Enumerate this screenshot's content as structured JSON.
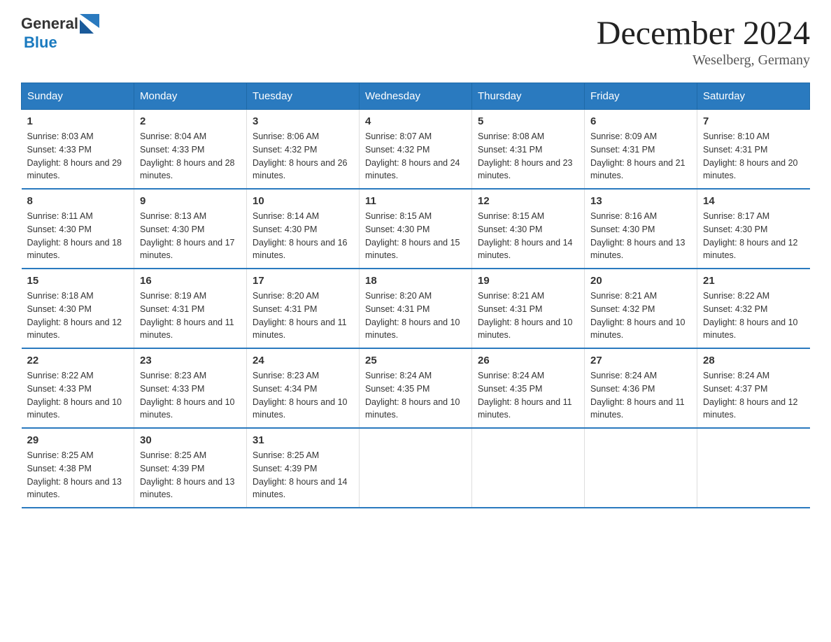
{
  "header": {
    "logo_text_general": "General",
    "logo_text_blue": "Blue",
    "month_title": "December 2024",
    "location": "Weselberg, Germany"
  },
  "days_of_week": [
    "Sunday",
    "Monday",
    "Tuesday",
    "Wednesday",
    "Thursday",
    "Friday",
    "Saturday"
  ],
  "weeks": [
    [
      {
        "day": "1",
        "sunrise": "8:03 AM",
        "sunset": "4:33 PM",
        "daylight": "8 hours and 29 minutes."
      },
      {
        "day": "2",
        "sunrise": "8:04 AM",
        "sunset": "4:33 PM",
        "daylight": "8 hours and 28 minutes."
      },
      {
        "day": "3",
        "sunrise": "8:06 AM",
        "sunset": "4:32 PM",
        "daylight": "8 hours and 26 minutes."
      },
      {
        "day": "4",
        "sunrise": "8:07 AM",
        "sunset": "4:32 PM",
        "daylight": "8 hours and 24 minutes."
      },
      {
        "day": "5",
        "sunrise": "8:08 AM",
        "sunset": "4:31 PM",
        "daylight": "8 hours and 23 minutes."
      },
      {
        "day": "6",
        "sunrise": "8:09 AM",
        "sunset": "4:31 PM",
        "daylight": "8 hours and 21 minutes."
      },
      {
        "day": "7",
        "sunrise": "8:10 AM",
        "sunset": "4:31 PM",
        "daylight": "8 hours and 20 minutes."
      }
    ],
    [
      {
        "day": "8",
        "sunrise": "8:11 AM",
        "sunset": "4:30 PM",
        "daylight": "8 hours and 18 minutes."
      },
      {
        "day": "9",
        "sunrise": "8:13 AM",
        "sunset": "4:30 PM",
        "daylight": "8 hours and 17 minutes."
      },
      {
        "day": "10",
        "sunrise": "8:14 AM",
        "sunset": "4:30 PM",
        "daylight": "8 hours and 16 minutes."
      },
      {
        "day": "11",
        "sunrise": "8:15 AM",
        "sunset": "4:30 PM",
        "daylight": "8 hours and 15 minutes."
      },
      {
        "day": "12",
        "sunrise": "8:15 AM",
        "sunset": "4:30 PM",
        "daylight": "8 hours and 14 minutes."
      },
      {
        "day": "13",
        "sunrise": "8:16 AM",
        "sunset": "4:30 PM",
        "daylight": "8 hours and 13 minutes."
      },
      {
        "day": "14",
        "sunrise": "8:17 AM",
        "sunset": "4:30 PM",
        "daylight": "8 hours and 12 minutes."
      }
    ],
    [
      {
        "day": "15",
        "sunrise": "8:18 AM",
        "sunset": "4:30 PM",
        "daylight": "8 hours and 12 minutes."
      },
      {
        "day": "16",
        "sunrise": "8:19 AM",
        "sunset": "4:31 PM",
        "daylight": "8 hours and 11 minutes."
      },
      {
        "day": "17",
        "sunrise": "8:20 AM",
        "sunset": "4:31 PM",
        "daylight": "8 hours and 11 minutes."
      },
      {
        "day": "18",
        "sunrise": "8:20 AM",
        "sunset": "4:31 PM",
        "daylight": "8 hours and 10 minutes."
      },
      {
        "day": "19",
        "sunrise": "8:21 AM",
        "sunset": "4:31 PM",
        "daylight": "8 hours and 10 minutes."
      },
      {
        "day": "20",
        "sunrise": "8:21 AM",
        "sunset": "4:32 PM",
        "daylight": "8 hours and 10 minutes."
      },
      {
        "day": "21",
        "sunrise": "8:22 AM",
        "sunset": "4:32 PM",
        "daylight": "8 hours and 10 minutes."
      }
    ],
    [
      {
        "day": "22",
        "sunrise": "8:22 AM",
        "sunset": "4:33 PM",
        "daylight": "8 hours and 10 minutes."
      },
      {
        "day": "23",
        "sunrise": "8:23 AM",
        "sunset": "4:33 PM",
        "daylight": "8 hours and 10 minutes."
      },
      {
        "day": "24",
        "sunrise": "8:23 AM",
        "sunset": "4:34 PM",
        "daylight": "8 hours and 10 minutes."
      },
      {
        "day": "25",
        "sunrise": "8:24 AM",
        "sunset": "4:35 PM",
        "daylight": "8 hours and 10 minutes."
      },
      {
        "day": "26",
        "sunrise": "8:24 AM",
        "sunset": "4:35 PM",
        "daylight": "8 hours and 11 minutes."
      },
      {
        "day": "27",
        "sunrise": "8:24 AM",
        "sunset": "4:36 PM",
        "daylight": "8 hours and 11 minutes."
      },
      {
        "day": "28",
        "sunrise": "8:24 AM",
        "sunset": "4:37 PM",
        "daylight": "8 hours and 12 minutes."
      }
    ],
    [
      {
        "day": "29",
        "sunrise": "8:25 AM",
        "sunset": "4:38 PM",
        "daylight": "8 hours and 13 minutes."
      },
      {
        "day": "30",
        "sunrise": "8:25 AM",
        "sunset": "4:39 PM",
        "daylight": "8 hours and 13 minutes."
      },
      {
        "day": "31",
        "sunrise": "8:25 AM",
        "sunset": "4:39 PM",
        "daylight": "8 hours and 14 minutes."
      },
      null,
      null,
      null,
      null
    ]
  ],
  "labels": {
    "sunrise": "Sunrise:",
    "sunset": "Sunset:",
    "daylight": "Daylight:"
  }
}
